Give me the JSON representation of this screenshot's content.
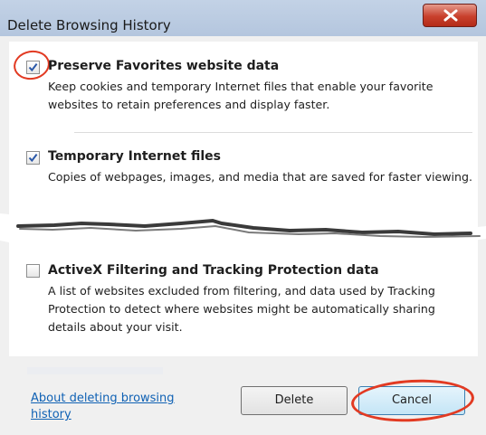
{
  "window": {
    "title": "Delete Browsing History",
    "close_icon": "close-x-icon"
  },
  "options": [
    {
      "title": "Preserve Favorites website data",
      "description": "Keep cookies and temporary Internet files that enable your favorite websites to retain preferences and display faster.",
      "checked": true
    },
    {
      "title": "Temporary Internet files",
      "description": "Copies of webpages, images, and media that are saved for faster viewing.",
      "checked": true
    },
    {
      "title": "ActiveX Filtering and Tracking Protection data",
      "description": "A list of websites excluded from filtering, and data used by Tracking Protection to detect where websites might be automatically sharing details about your visit.",
      "checked": false
    }
  ],
  "footer": {
    "help_link": "About deleting browsing history",
    "delete_label": "Delete",
    "cancel_label": "Cancel"
  },
  "colors": {
    "annotation": "#e23a22",
    "link": "#0f61b4",
    "check": "#2a58a8"
  }
}
